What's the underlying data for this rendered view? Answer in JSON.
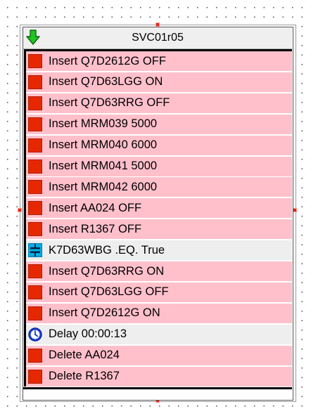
{
  "block": {
    "title": "SVC01r05",
    "header_icon": "green-down-arrow-icon"
  },
  "colors": {
    "action_row": "#ffc0cb",
    "condition_row": "#eeeeee",
    "action_marker": "#e62800",
    "condition_marker": "#00aee6",
    "delay_marker": "#1a3fd6",
    "selection_handle": "#e0261c"
  },
  "steps": [
    {
      "kind": "action",
      "icon": "red-square-icon",
      "label": "Insert Q7D2612G OFF"
    },
    {
      "kind": "action",
      "icon": "red-square-icon",
      "label": "Insert Q7D63LGG ON"
    },
    {
      "kind": "action",
      "icon": "red-square-icon",
      "label": "Insert Q7D63RRG OFF"
    },
    {
      "kind": "action",
      "icon": "red-square-icon",
      "label": "Insert MRM039 5000"
    },
    {
      "kind": "action",
      "icon": "red-square-icon",
      "label": "Insert MRM040 6000"
    },
    {
      "kind": "action",
      "icon": "red-square-icon",
      "label": "Insert MRM041 5000"
    },
    {
      "kind": "action",
      "icon": "red-square-icon",
      "label": "Insert MRM042 6000"
    },
    {
      "kind": "action",
      "icon": "red-square-icon",
      "label": "Insert AA024 OFF"
    },
    {
      "kind": "action",
      "icon": "red-square-icon",
      "label": "Insert R1367 OFF"
    },
    {
      "kind": "condition",
      "icon": "equals-condition-icon",
      "label": "K7D63WBG .EQ. True"
    },
    {
      "kind": "action",
      "icon": "red-square-icon",
      "label": "Insert Q7D63RRG ON"
    },
    {
      "kind": "action",
      "icon": "red-square-icon",
      "label": "Insert Q7D63LGG OFF"
    },
    {
      "kind": "action",
      "icon": "red-square-icon",
      "label": "Insert Q7D2612G ON"
    },
    {
      "kind": "delay",
      "icon": "clock-icon",
      "label": "Delay 00:00:13"
    },
    {
      "kind": "action",
      "icon": "red-square-icon",
      "label": "Delete AA024"
    },
    {
      "kind": "action",
      "icon": "red-square-icon",
      "label": "Delete R1367"
    }
  ]
}
